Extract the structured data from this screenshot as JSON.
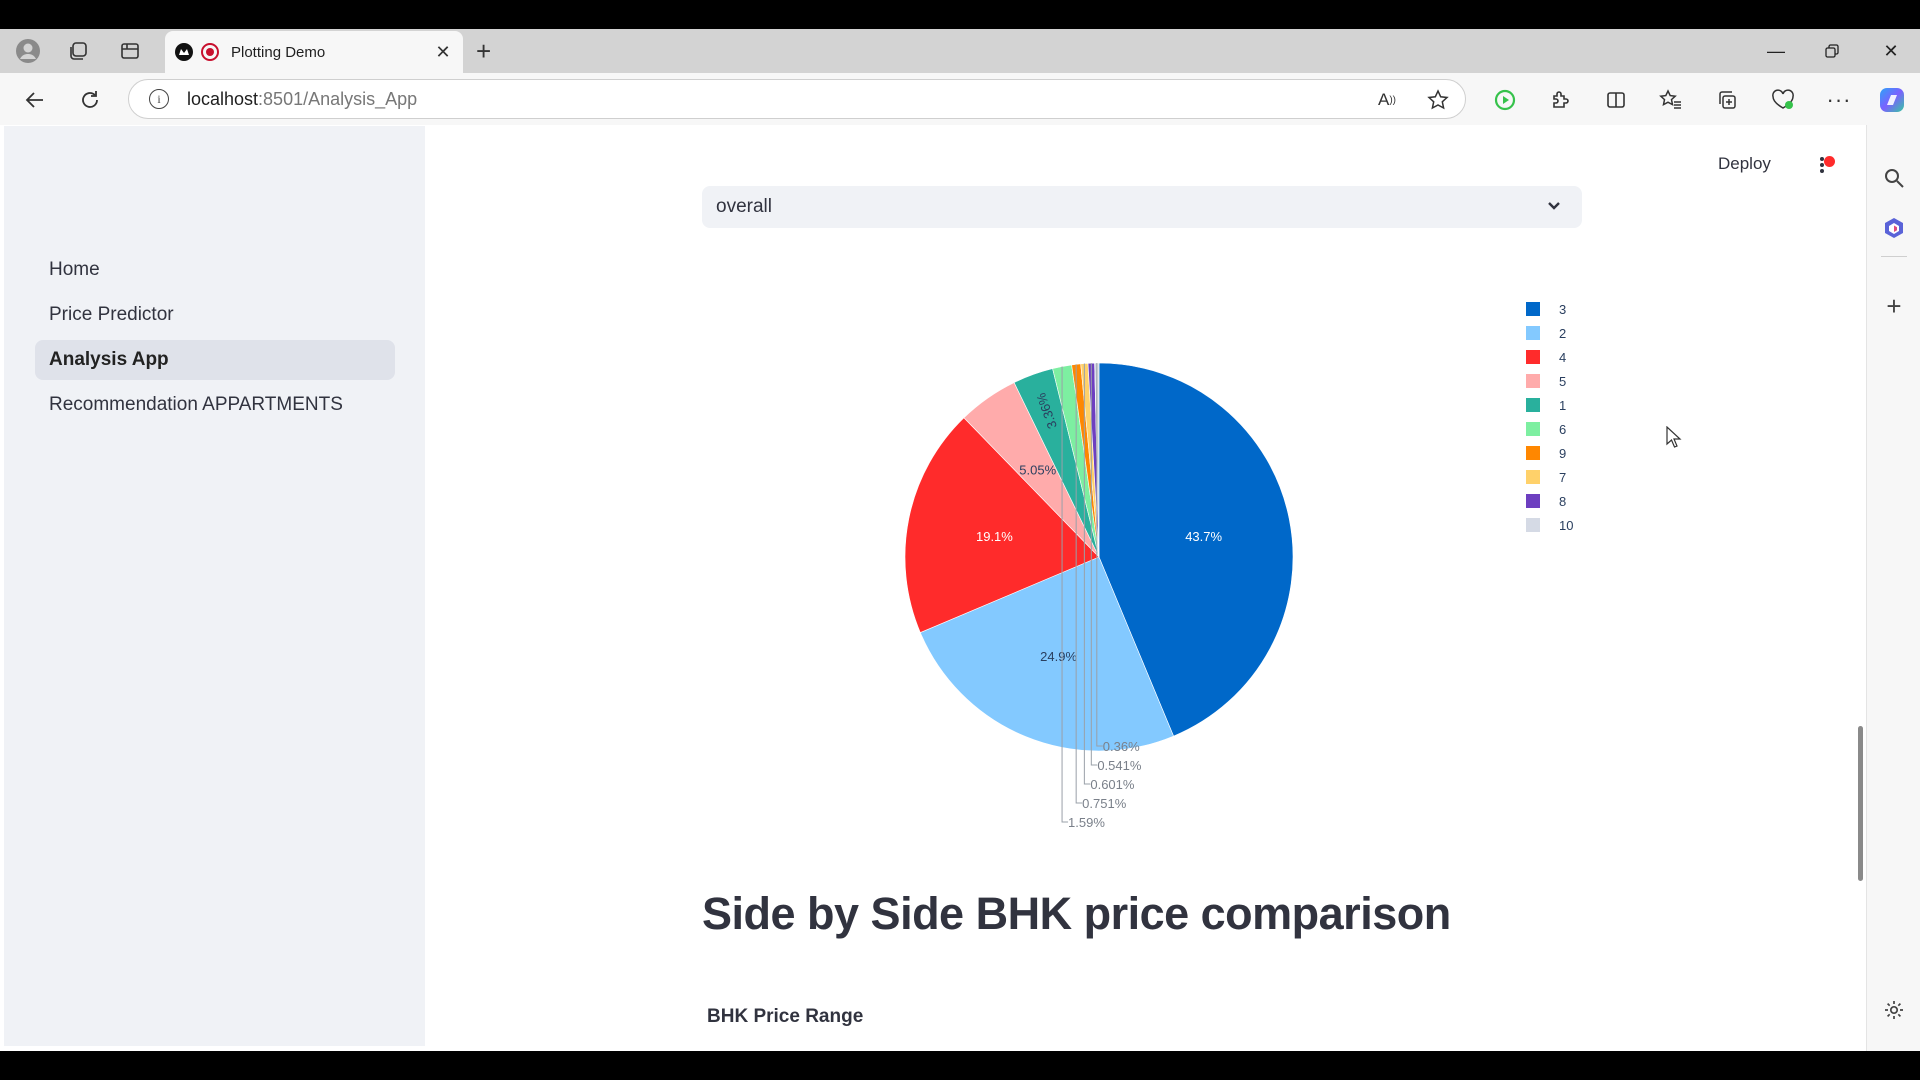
{
  "browser": {
    "tab_title": "Plotting Demo",
    "url_host": "localhost",
    "url_rest": ":8501/Analysis_App"
  },
  "sidebar": {
    "items": [
      {
        "label": "Home",
        "active": false
      },
      {
        "label": "Price Predictor",
        "active": false
      },
      {
        "label": "Analysis App",
        "active": true
      },
      {
        "label": "Recommendation APPARTMENTS",
        "active": false
      }
    ]
  },
  "header": {
    "deploy_label": "Deploy"
  },
  "select": {
    "value": "overall"
  },
  "chart_data": {
    "type": "pie",
    "labels": [
      "3",
      "2",
      "4",
      "5",
      "1",
      "6",
      "9",
      "7",
      "8",
      "10"
    ],
    "values": [
      43.7,
      24.9,
      19.1,
      5.05,
      3.36,
      1.59,
      0.751,
      0.601,
      0.541,
      0.36
    ],
    "value_labels": [
      "43.7%",
      "24.9%",
      "19.1%",
      "5.05%",
      "3.36%",
      "1.59%",
      "0.751%",
      "0.601%",
      "0.541%",
      "0.36%"
    ],
    "colors": [
      "#0068c9",
      "#83c9ff",
      "#ff2b2b",
      "#ffabab",
      "#29b09d",
      "#7defa1",
      "#ff8700",
      "#ffd16a",
      "#6d3fc0",
      "#d5dae5"
    ],
    "legend_placement": "right"
  },
  "main": {
    "heading": "Side by Side BHK price comparison",
    "subheading": "BHK Price Range"
  }
}
